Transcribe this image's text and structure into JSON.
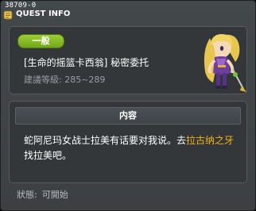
{
  "quest_id": "38709-0",
  "title_bar": {
    "title": "QUEST INFO"
  },
  "quest": {
    "badge": "一般",
    "name": "[生命的摇篮卡西翁] 秘密委托",
    "level_label": "建議等級:",
    "level_range": "285~289"
  },
  "content": {
    "header": "内容",
    "description_before": "蛇阿尼玛女战士拉美有话要对我说。去",
    "description_highlight": "拉古纳之牙",
    "description_after": "找拉美吧。"
  },
  "status": {
    "label": "狀態:",
    "value": "可開始"
  },
  "colors": {
    "highlight": "#f2b21c",
    "badge_green": "#8cc02a",
    "panel_bg": "#33373a"
  },
  "icons": {
    "title": "quest-scroll-icon",
    "npc": "npc-portrait"
  }
}
